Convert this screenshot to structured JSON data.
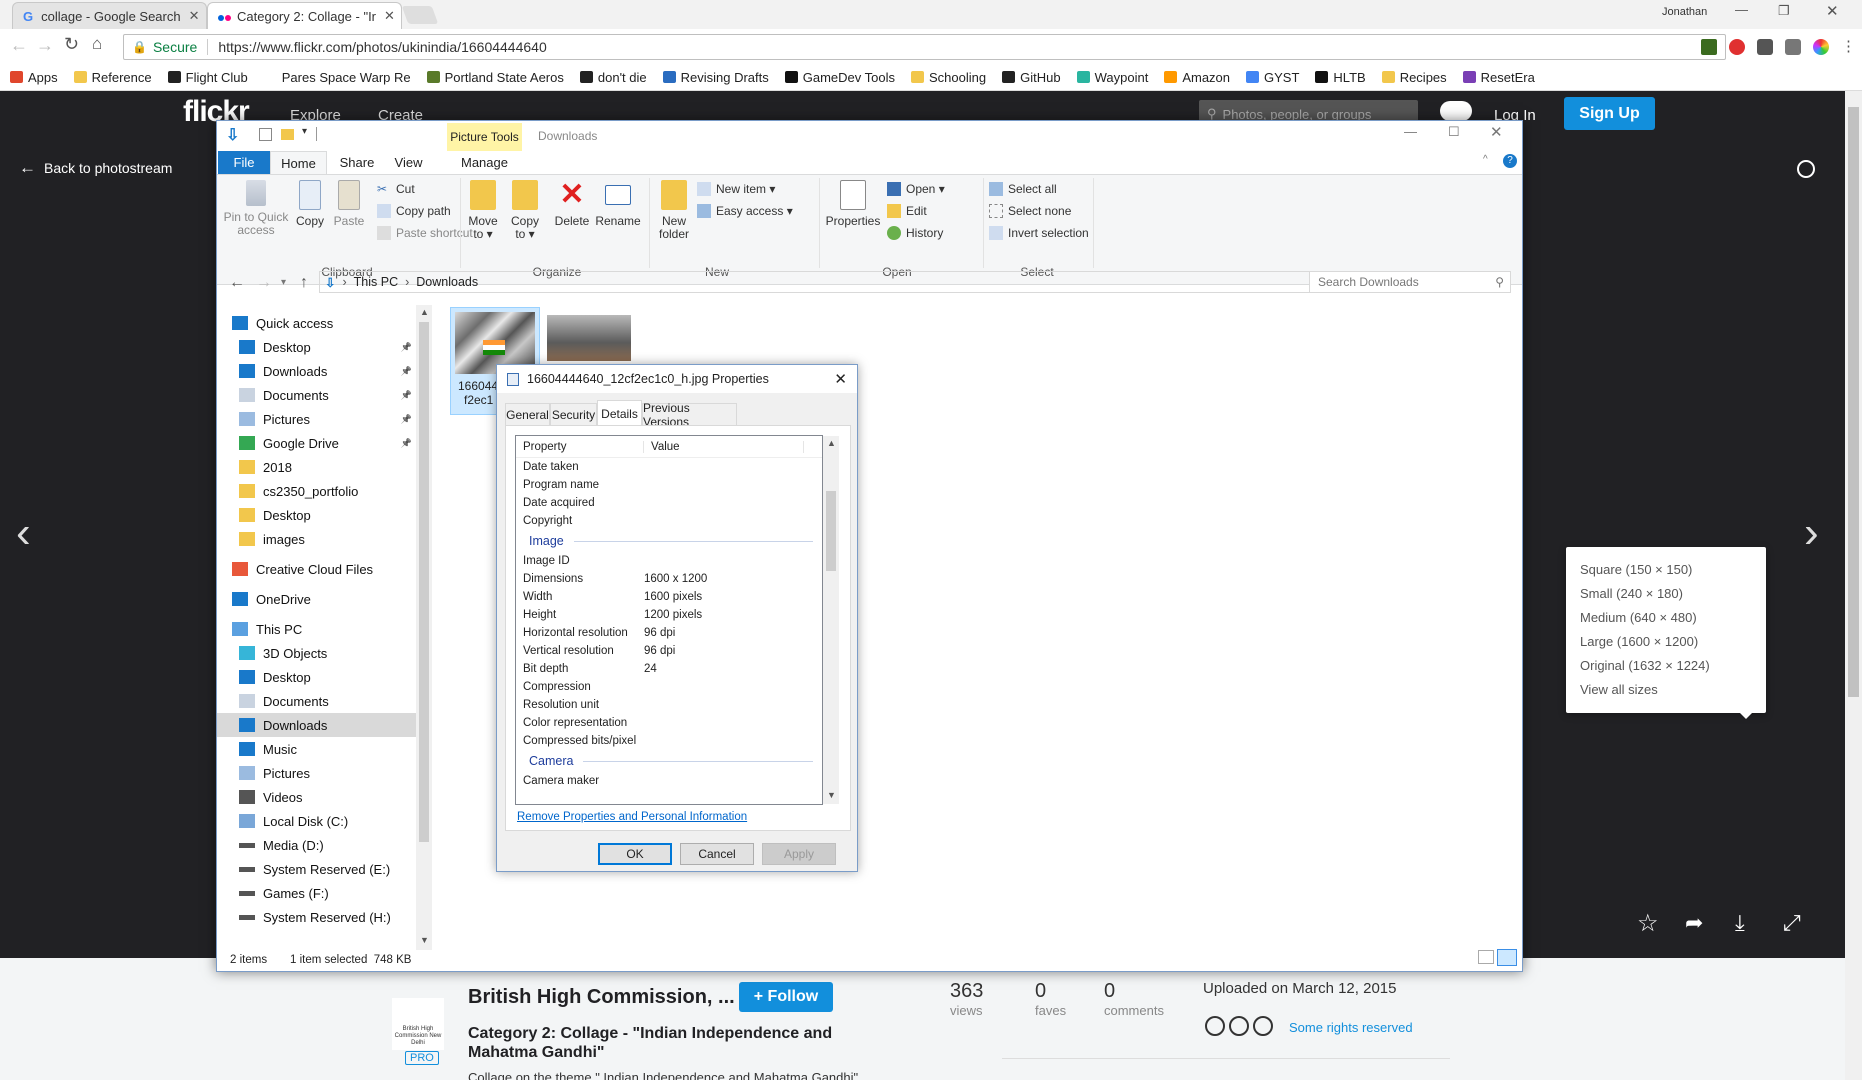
{
  "browser": {
    "tabs": [
      {
        "title": "collage - Google Search",
        "close": "✕"
      },
      {
        "title": "Category 2: Collage - \"Ir",
        "close": "✕"
      }
    ],
    "user": "Jonathan",
    "secure_label": "Secure",
    "url": "https://www.flickr.com/photos/ukinindia/16604444640",
    "bookmarks": [
      "Apps",
      "Reference",
      "Flight Club",
      "Pares Space Warp Re",
      "Portland State Aeros",
      "don't die",
      "Revising Drafts",
      "GameDev Tools",
      "Schooling",
      "GitHub",
      "Waypoint",
      "Amazon",
      "GYST",
      "HLTB",
      "Recipes",
      "ResetEra"
    ]
  },
  "flickr": {
    "logo": "flickr",
    "nav": [
      "Explore",
      "Create"
    ],
    "search_placeholder": "Photos, people, or groups",
    "login": "Log In",
    "signup": "Sign Up",
    "back": "Back to photostream",
    "size_menu": [
      "Square (150 × 150)",
      "Small (240 × 180)",
      "Medium (640 × 480)",
      "Large (1600 × 1200)",
      "Original (1632 × 1224)",
      "View all sizes"
    ],
    "owner": "British High Commission, ...",
    "follow": "+ Follow",
    "pro_badge": "PRO",
    "logo_caption": "British High Commission New Delhi",
    "title": "Category 2: Collage - \"Indian Independence and Mahatma Gandhi\"",
    "description": "Collage on the theme \" Indian Independence and Mahatma Gandhi\"",
    "stats": [
      {
        "value": "363",
        "label": "views"
      },
      {
        "value": "0",
        "label": "faves"
      },
      {
        "value": "0",
        "label": "comments"
      }
    ],
    "uploaded": "Uploaded on March 12, 2015",
    "license": "Some rights reserved"
  },
  "explorer": {
    "title": "Downloads",
    "picture_tools": "Picture Tools",
    "ribbon_tabs": [
      "File",
      "Home",
      "Share",
      "View",
      "Manage"
    ],
    "clipboard": {
      "pin": "Pin to Quick access",
      "copy": "Copy",
      "paste": "Paste",
      "cut": "Cut",
      "copy_path": "Copy path",
      "paste_shortcut": "Paste shortcut",
      "group": "Clipboard"
    },
    "organize": {
      "move": "Move to ▾",
      "copy": "Copy to ▾",
      "delete": "Delete",
      "rename": "Rename",
      "group": "Organize"
    },
    "new": {
      "folder": "New folder",
      "item": "New item ▾",
      "easy": "Easy access ▾",
      "group": "New"
    },
    "open": {
      "properties": "Properties",
      "open": "Open ▾",
      "edit": "Edit",
      "history": "History",
      "group": "Open"
    },
    "select": {
      "all": "Select all",
      "none": "Select none",
      "invert": "Invert selection",
      "group": "Select"
    },
    "breadcrumb": [
      "This PC",
      "Downloads"
    ],
    "search_placeholder": "Search Downloads",
    "nav": [
      {
        "label": "Quick access",
        "level": 0,
        "icon": "star-icon",
        "pin": ""
      },
      {
        "label": "Desktop",
        "level": 1,
        "icon": "desktop-icon",
        "pin": "📌"
      },
      {
        "label": "Downloads",
        "level": 1,
        "icon": "download-icon",
        "pin": "📌"
      },
      {
        "label": "Documents",
        "level": 1,
        "icon": "document-icon",
        "pin": "📌"
      },
      {
        "label": "Pictures",
        "level": 1,
        "icon": "pictures-icon",
        "pin": "📌"
      },
      {
        "label": "Google Drive",
        "level": 1,
        "icon": "drive-icon",
        "pin": "📌"
      },
      {
        "label": "2018",
        "level": 1,
        "icon": "folder-icon",
        "pin": ""
      },
      {
        "label": "cs2350_portfolio",
        "level": 1,
        "icon": "folder-icon",
        "pin": ""
      },
      {
        "label": "Desktop",
        "level": 1,
        "icon": "folder-icon",
        "pin": ""
      },
      {
        "label": "images",
        "level": 1,
        "icon": "folder-icon",
        "pin": ""
      },
      {
        "label": "Creative Cloud Files",
        "level": 0,
        "icon": "creative-cloud-icon",
        "pin": ""
      },
      {
        "label": "OneDrive",
        "level": 0,
        "icon": "onedrive-icon",
        "pin": ""
      },
      {
        "label": "This PC",
        "level": 0,
        "icon": "pc-icon",
        "pin": ""
      },
      {
        "label": "3D Objects",
        "level": 1,
        "icon": "cube-icon",
        "pin": ""
      },
      {
        "label": "Desktop",
        "level": 1,
        "icon": "desktop-icon",
        "pin": ""
      },
      {
        "label": "Documents",
        "level": 1,
        "icon": "document-icon",
        "pin": ""
      },
      {
        "label": "Downloads",
        "level": 1,
        "icon": "download-icon",
        "pin": ""
      },
      {
        "label": "Music",
        "level": 1,
        "icon": "music-icon",
        "pin": ""
      },
      {
        "label": "Pictures",
        "level": 1,
        "icon": "pictures-icon",
        "pin": ""
      },
      {
        "label": "Videos",
        "level": 1,
        "icon": "videos-icon",
        "pin": ""
      },
      {
        "label": "Local Disk (C:)",
        "level": 1,
        "icon": "disk-icon",
        "pin": ""
      },
      {
        "label": "Media (D:)",
        "level": 1,
        "icon": "drive-bar-icon",
        "pin": ""
      },
      {
        "label": "System Reserved (E:)",
        "level": 1,
        "icon": "drive-bar-icon",
        "pin": ""
      },
      {
        "label": "Games (F:)",
        "level": 1,
        "icon": "drive-bar-icon",
        "pin": ""
      },
      {
        "label": "System Reserved (H:)",
        "level": 1,
        "icon": "drive-bar-icon",
        "pin": ""
      }
    ],
    "file_caption": [
      "166044",
      "f2ec1"
    ],
    "status_items": "2 items",
    "status_selected": "1 item selected  748 KB"
  },
  "dialog": {
    "title": "16604444640_12cf2ec1c0_h.jpg Properties",
    "tabs": [
      "General",
      "Security",
      "Details",
      "Previous Versions"
    ],
    "col_property": "Property",
    "col_value": "Value",
    "rows_a": [
      [
        "Date taken",
        ""
      ],
      [
        "Program name",
        ""
      ],
      [
        "Date acquired",
        ""
      ],
      [
        "Copyright",
        ""
      ]
    ],
    "section_image": "Image",
    "rows_b": [
      [
        "Image ID",
        ""
      ],
      [
        "Dimensions",
        "1600 x 1200"
      ],
      [
        "Width",
        "1600 pixels"
      ],
      [
        "Height",
        "1200 pixels"
      ],
      [
        "Horizontal resolution",
        "96 dpi"
      ],
      [
        "Vertical resolution",
        "96 dpi"
      ],
      [
        "Bit depth",
        "24"
      ],
      [
        "Compression",
        ""
      ],
      [
        "Resolution unit",
        ""
      ],
      [
        "Color representation",
        ""
      ],
      [
        "Compressed bits/pixel",
        ""
      ]
    ],
    "section_camera": "Camera",
    "rows_c": [
      [
        "Camera maker",
        ""
      ]
    ],
    "remove_link": "Remove Properties and Personal Information",
    "ok": "OK",
    "cancel": "Cancel",
    "apply": "Apply"
  },
  "colors": {
    "flickr_blue": "#128fdc",
    "win_blue": "#1979ca",
    "accent_link": "#0066cc"
  }
}
